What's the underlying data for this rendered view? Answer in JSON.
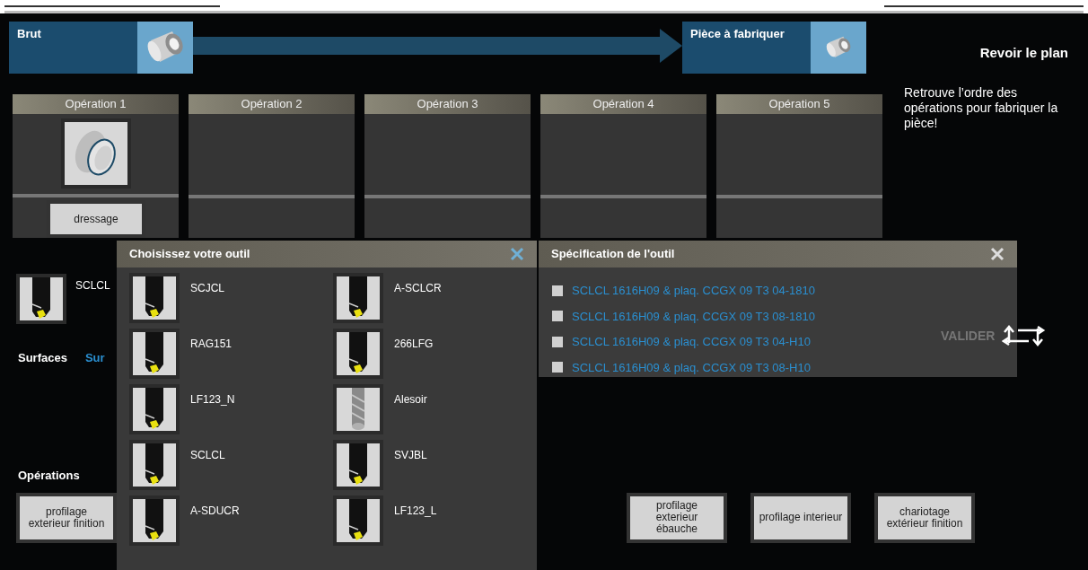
{
  "header": {
    "raw_part": {
      "label": "Brut"
    },
    "finished_part": {
      "label": "Pièce à fabriquer"
    },
    "review_link": "Revoir le plan"
  },
  "operations": [
    {
      "title": "Opération 1",
      "operation": "dressage"
    },
    {
      "title": "Opération 2"
    },
    {
      "title": "Opération 3"
    },
    {
      "title": "Opération 4"
    },
    {
      "title": "Opération 5"
    }
  ],
  "instruction": "Retrouve  l’ordre des opérations pour fabriquer la pièce!",
  "current_tool": {
    "name": "SCLCL"
  },
  "surfaces": {
    "label": "Surfaces",
    "legend": "Sur"
  },
  "operations_palette": {
    "label": "Opérations",
    "buttons": [
      {
        "label": "profilage exterieur finition"
      },
      {
        "label": "profilage exterieur ébauche"
      },
      {
        "label": "profilage interieur"
      },
      {
        "label": "chariotage extérieur finition"
      }
    ]
  },
  "tool_dialog": {
    "title": "Choisissez votre outil",
    "tools": [
      {
        "name": "SCJCL",
        "kind": "holder"
      },
      {
        "name": "A-SCLCR",
        "kind": "holder"
      },
      {
        "name": "RAG151",
        "kind": "holder"
      },
      {
        "name": "266LFG",
        "kind": "holder"
      },
      {
        "name": "LF123_N",
        "kind": "holder"
      },
      {
        "name": "Alesoir",
        "kind": "reamer"
      },
      {
        "name": "SCLCL",
        "kind": "holder"
      },
      {
        "name": "SVJBL",
        "kind": "holder"
      },
      {
        "name": "A-SDUCR",
        "kind": "holder"
      },
      {
        "name": "LF123_L",
        "kind": "holder"
      }
    ]
  },
  "spec_dialog": {
    "title": "Spécification de l'outil",
    "options": [
      {
        "label": "SCLCL 1616H09 & plaq. CCGX 09 T3 04-1810",
        "checked": false
      },
      {
        "label": "SCLCL 1616H09 & plaq. CCGX 09 T3 08-1810",
        "checked": false
      },
      {
        "label": "SCLCL 1616H09 & plaq. CCGX 09 T3 04-H10",
        "checked": false
      },
      {
        "label": "SCLCL 1616H09 & plaq. CCGX 09 T3 08-H10",
        "checked": false
      }
    ]
  },
  "validate": "VALIDER"
}
